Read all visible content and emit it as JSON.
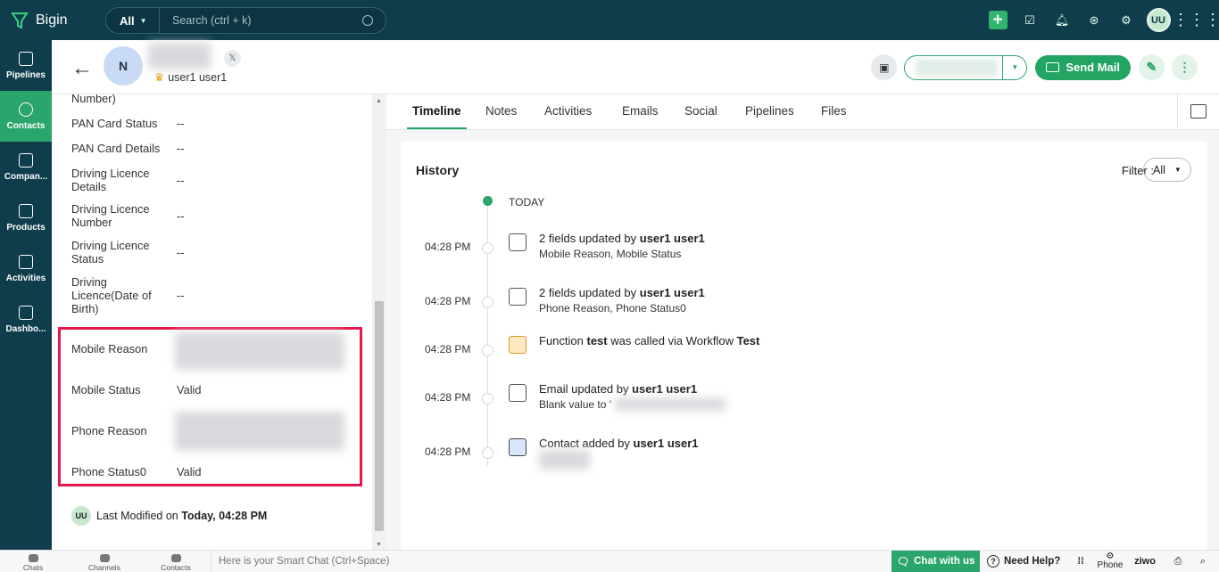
{
  "topbar": {
    "app_name": "Bigin",
    "search_scope": "All",
    "search_placeholder": "Search (ctrl + k)",
    "user_initials": "UU",
    "icons": [
      "plus-icon",
      "task-check-icon",
      "bell-icon",
      "zia-icon",
      "gear-icon",
      "avatar",
      "apps-grid-icon"
    ]
  },
  "sidebar": {
    "items": [
      {
        "label": "Pipelines",
        "icon": "pipelines-icon",
        "active": false
      },
      {
        "label": "Contacts",
        "icon": "contacts-icon",
        "active": true
      },
      {
        "label": "Compan...",
        "icon": "companies-icon",
        "active": false
      },
      {
        "label": "Products",
        "icon": "cart-icon",
        "active": false
      },
      {
        "label": "Activities",
        "icon": "activities-icon",
        "active": false
      },
      {
        "label": "Dashbo...",
        "icon": "dashboard-icon",
        "active": false
      }
    ]
  },
  "header": {
    "avatar_initial": "N",
    "owner": "user1 user1",
    "send_mail_label": "Send Mail"
  },
  "details": {
    "fields": [
      {
        "label": "Number)",
        "value": ""
      },
      {
        "label": "PAN Card Status",
        "value": "--"
      },
      {
        "label": "PAN Card Details",
        "value": "--"
      },
      {
        "label": "Driving Licence Details",
        "value": "--"
      },
      {
        "label": "Driving Licence Number",
        "value": "--"
      },
      {
        "label": "Driving Licence Status",
        "value": "--"
      },
      {
        "label": "Driving Licence(Date of Birth)",
        "value": "--"
      },
      {
        "label": "Mobile Reason",
        "value": ""
      },
      {
        "label": "Mobile Status",
        "value": "Valid"
      },
      {
        "label": "Phone Reason",
        "value": ""
      },
      {
        "label": "Phone Status0",
        "value": "Valid"
      }
    ],
    "last_modified_avatar": "UU",
    "last_modified_label": "Last Modified on",
    "last_modified_value": "Today, 04:28 PM"
  },
  "tabs": [
    {
      "label": "Timeline",
      "active": true
    },
    {
      "label": "Notes",
      "active": false
    },
    {
      "label": "Activities",
      "active": false
    },
    {
      "label": "Emails",
      "active": false
    },
    {
      "label": "Social",
      "active": false
    },
    {
      "label": "Pipelines",
      "active": false
    },
    {
      "label": "Files",
      "active": false
    }
  ],
  "history": {
    "title": "History",
    "filter_label": "Filter :",
    "filter_value": "All",
    "today_label": "TODAY",
    "events": [
      {
        "time": "04:28 PM",
        "icon": "field-update-icon",
        "pre": "2 fields updated by ",
        "bold": "user1 user1",
        "post": "",
        "bold2": "",
        "sub": "Mobile Reason, Mobile Status"
      },
      {
        "time": "04:28 PM",
        "icon": "field-update-icon",
        "pre": "2 fields updated by ",
        "bold": "user1 user1",
        "post": "",
        "bold2": "",
        "sub": "Phone Reason, Phone Status0"
      },
      {
        "time": "04:28 PM",
        "icon": "function-icon",
        "pre": "Function ",
        "bold": "test",
        "post": " was called via Workflow ",
        "bold2": "Test",
        "sub": ""
      },
      {
        "time": "04:28 PM",
        "icon": "field-update-icon",
        "pre": "Email updated by ",
        "bold": "user1 user1",
        "post": "",
        "bold2": "",
        "sub": "Blank value to '"
      },
      {
        "time": "04:28 PM",
        "icon": "contact-icon",
        "pre": "Contact added by ",
        "bold": "user1 user1",
        "post": "",
        "bold2": "",
        "sub": ""
      }
    ]
  },
  "bottombar": {
    "chats": "Chats",
    "channels": "Channels",
    "contacts": "Contacts",
    "smart_chat": "Here is your Smart Chat (Ctrl+Space)",
    "chat_with_us": "Chat with us",
    "need_help": "Need Help?",
    "phone": "Phone",
    "ziwo": "ziwo"
  }
}
